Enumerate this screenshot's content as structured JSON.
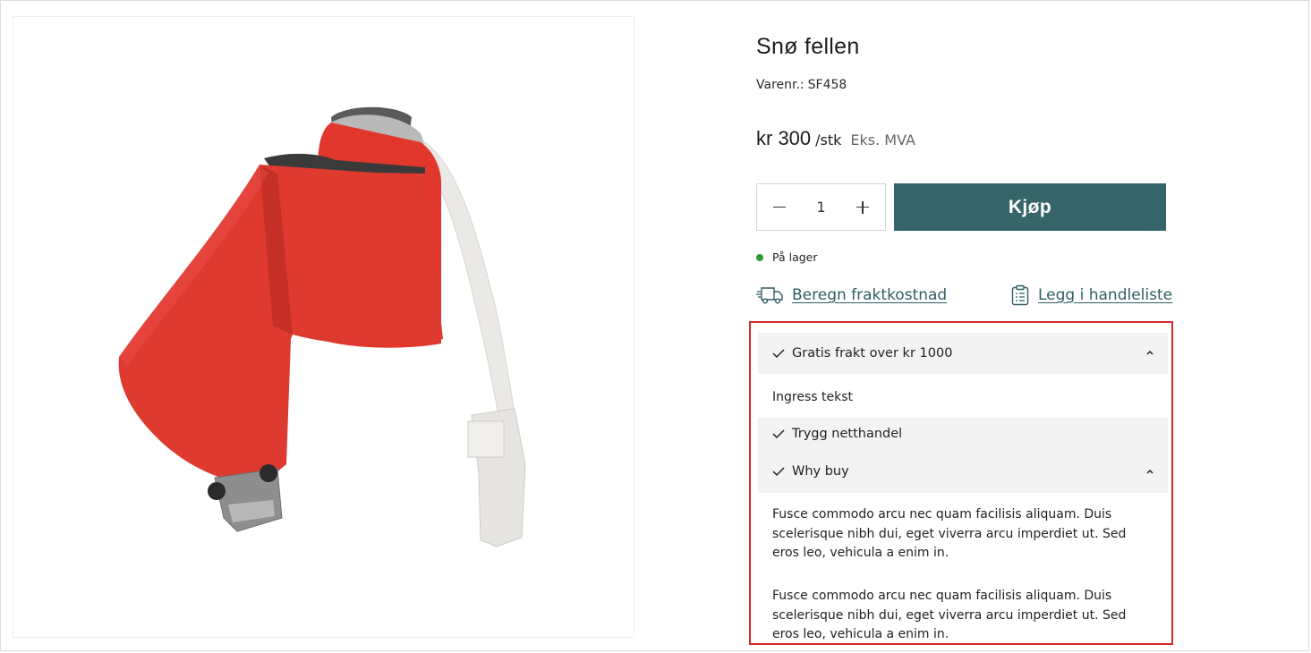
{
  "product": {
    "title": "Snø fellen",
    "sku_label": "Varenr.:",
    "sku_value": "SF458",
    "price": "kr 300",
    "unit": "/stk",
    "vat_note": "Eks. MVA",
    "stock_status": "På lager",
    "stock_color": "#2e9a2e"
  },
  "purchase": {
    "quantity": "1",
    "buy_label": "Kjøp",
    "buy_color": "#35646a"
  },
  "links": {
    "shipping": "Beregn fraktkostnad",
    "shipping_icon": "truck-icon",
    "shopping_list": "Legg i handleliste",
    "shopping_list_icon": "clipboard-icon"
  },
  "accordion": {
    "free_shipping": {
      "label": "Gratis frakt over kr 1000",
      "body": "Ingress tekst"
    },
    "secure_shop": {
      "label": "Trygg netthandel"
    },
    "why_buy": {
      "label": "Why buy",
      "paragraphs": [
        "Fusce commodo arcu nec quam facilisis aliquam. Duis scelerisque nibh dui, eget viverra arcu imperdiet ut. Sed eros leo, vehicula a enim in.",
        "Fusce commodo arcu nec quam facilisis aliquam. Duis scelerisque nibh dui, eget viverra arcu imperdiet ut. Sed eros leo, vehicula a enim in."
      ]
    },
    "highlight_color": "#d32a2a"
  }
}
